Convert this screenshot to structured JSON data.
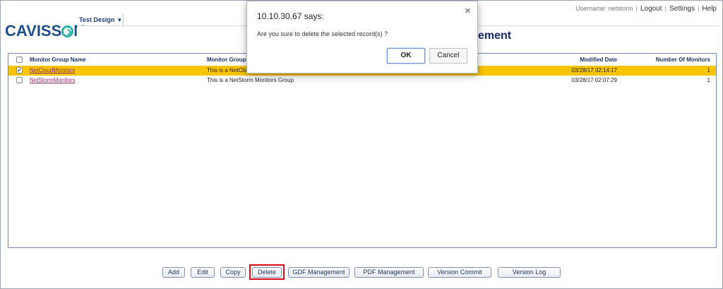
{
  "header": {
    "username_label": "Username: netstorm",
    "logout": "Logout",
    "settings": "Settings",
    "help": "Help",
    "logo": "CAVISSON",
    "menu": "Test Design",
    "page_title": "ement"
  },
  "table": {
    "columns": [
      "Monitor Group Name",
      "Monitor Group",
      "Modified Date",
      "Number Of Monitors"
    ],
    "rows": [
      {
        "checked": true,
        "name": "NetCloudMonitors",
        "description": "This is a NetClo",
        "modified": "03/28/17 02:14:17",
        "count": "1"
      },
      {
        "checked": false,
        "name": "NetStormMonitors",
        "description": "This is a NetStorm Monitors Group",
        "modified": "03/28/17 02:07:29",
        "count": "1"
      }
    ]
  },
  "toolbar": {
    "add": "Add",
    "edit": "Edit",
    "copy": "Copy",
    "delete": "Delete",
    "gdf": "GDF Management",
    "pdf": "PDF Management",
    "version_commit": "Version Commit",
    "version_log": "Version Log"
  },
  "dialog": {
    "title": "10.10.30.67 says:",
    "message": "Are you sure to delete the selected record(s) ?",
    "ok": "OK",
    "cancel": "Cancel"
  },
  "colors": {
    "selected_row": "#f7c500",
    "highlight_box": "#d80f1a",
    "title": "#172a6a"
  }
}
